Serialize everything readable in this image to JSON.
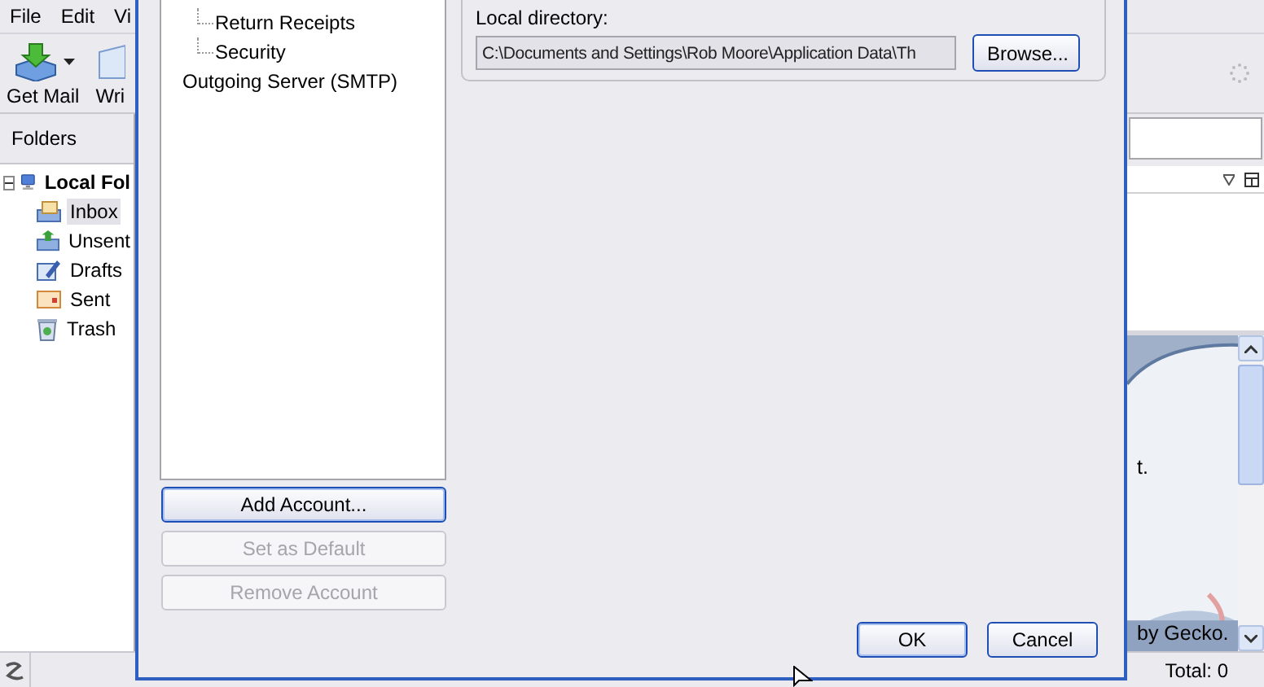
{
  "menu": [
    "File",
    "Edit",
    "Vi"
  ],
  "toolbar": [
    {
      "label": "Get Mail",
      "kind": "dropdown"
    },
    {
      "label": "Wri",
      "kind": "plain"
    }
  ],
  "folders_header": "Folders",
  "folders": [
    {
      "label": "Local Fol",
      "kind": "computer",
      "expanded": true,
      "children": [
        {
          "label": "Inbox",
          "kind": "inbox",
          "selected": true
        },
        {
          "label": "Unsent",
          "kind": "outbox",
          "selected": false
        },
        {
          "label": "Drafts",
          "kind": "drafts",
          "selected": false
        },
        {
          "label": "Sent",
          "kind": "sent",
          "selected": false
        },
        {
          "label": "Trash",
          "kind": "trash",
          "selected": false
        }
      ]
    }
  ],
  "preview": {
    "line": "t.",
    "footer": "by Gecko."
  },
  "status_bar": {
    "total": "Total: 0"
  },
  "dialog": {
    "account_tree": [
      {
        "children": [
          {
            "label": "Return Receipts"
          },
          {
            "label": "Security"
          }
        ]
      },
      {
        "label": "Outgoing Server (SMTP)"
      }
    ],
    "account_buttons": [
      {
        "label": "Add Account...",
        "disabled": false,
        "default": true
      },
      {
        "label": "Set as Default",
        "disabled": true,
        "default": false
      },
      {
        "label": "Remove Account",
        "disabled": true,
        "default": false
      }
    ],
    "local_directory": {
      "label": "Local directory:",
      "value": "C:\\Documents and Settings\\Rob Moore\\Application Data\\Th",
      "button": "Browse..."
    },
    "footer_buttons": [
      {
        "label": "OK",
        "default": true
      },
      {
        "label": "Cancel",
        "default": false
      }
    ]
  }
}
